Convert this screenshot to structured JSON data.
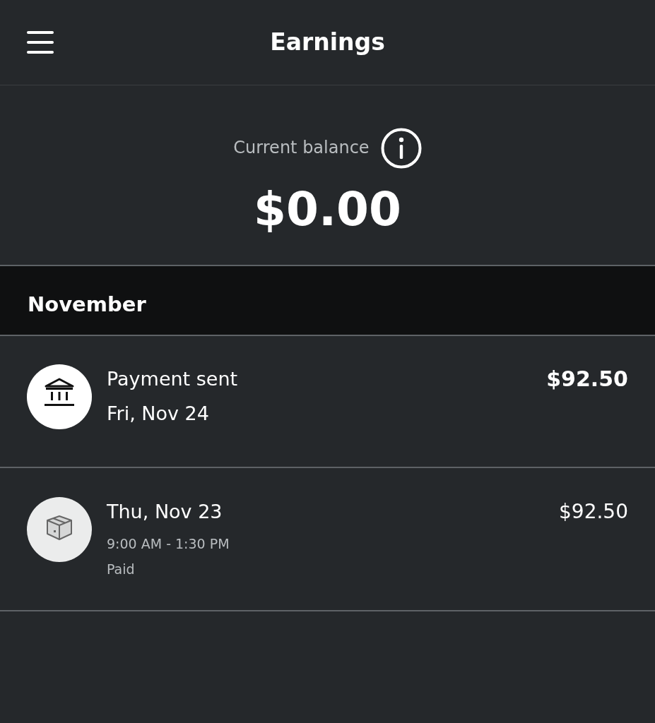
{
  "app_bar": {
    "title": "Earnings"
  },
  "balance": {
    "label": "Current balance",
    "amount": "$0.00"
  },
  "months": [
    {
      "name": "November",
      "items": [
        {
          "kind": "payment",
          "title": "Payment sent",
          "date": "Fri, Nov 24",
          "amount": "$92.50"
        },
        {
          "kind": "shift",
          "title": "Thu, Nov 23",
          "time": "9:00 AM - 1:30 PM",
          "status": "Paid",
          "amount": "$92.50"
        }
      ]
    }
  ]
}
